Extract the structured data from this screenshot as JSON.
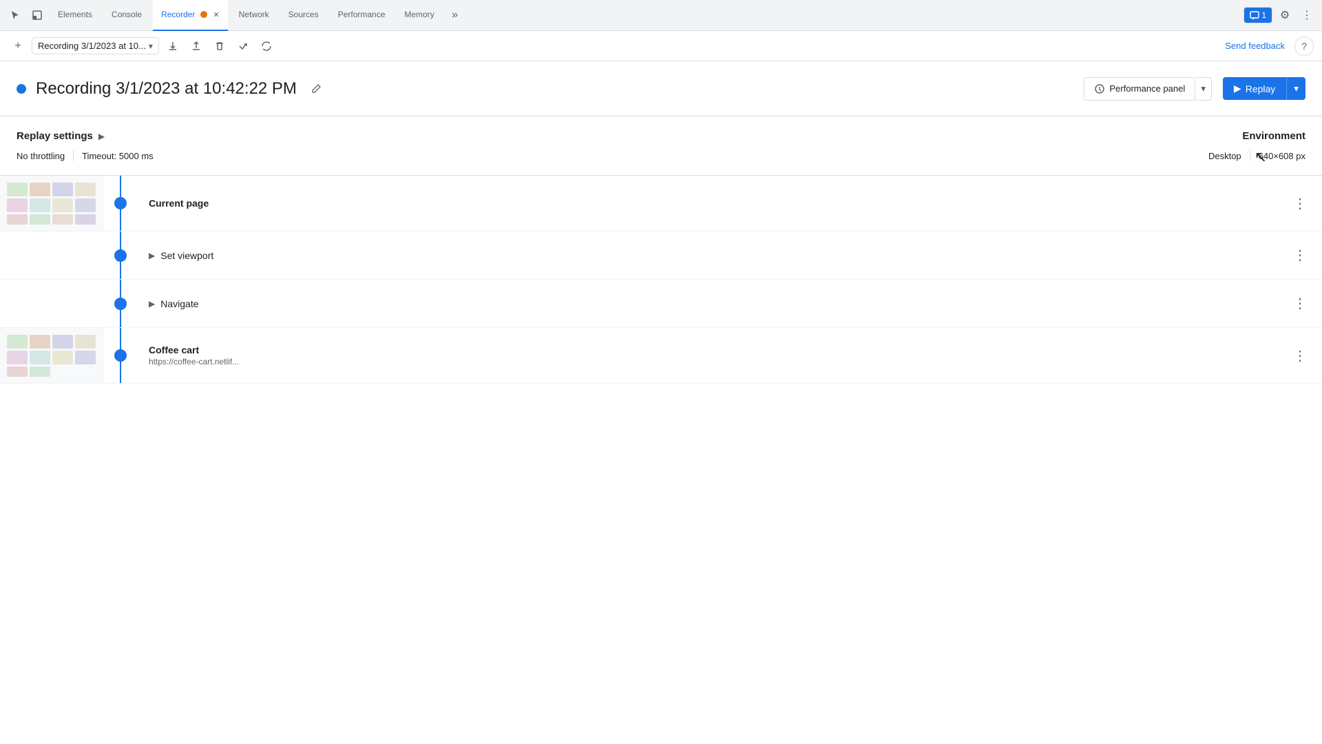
{
  "tabs": {
    "cursor_icon": "↖",
    "items": [
      {
        "id": "elements",
        "label": "Elements",
        "active": false
      },
      {
        "id": "console",
        "label": "Console",
        "active": false
      },
      {
        "id": "recorder",
        "label": "Recorder",
        "active": true,
        "has_close": true
      },
      {
        "id": "network",
        "label": "Network",
        "active": false
      },
      {
        "id": "sources",
        "label": "Sources",
        "active": false
      },
      {
        "id": "performance",
        "label": "Performance",
        "active": false
      },
      {
        "id": "memory",
        "label": "Memory",
        "active": false
      }
    ],
    "more_label": "»",
    "notification": {
      "count": "1"
    },
    "gear_icon": "⚙",
    "more_dots": "⋮"
  },
  "toolbar": {
    "add_icon": "+",
    "recording_name": "Recording 3/1/2023 at 10...",
    "dropdown_arrow": "▾",
    "export_icon": "↑",
    "import_icon": "↓",
    "delete_icon": "🗑",
    "step_over_icon": "⏭",
    "loop_icon": "↺",
    "send_feedback_label": "Send feedback",
    "help_icon": "?"
  },
  "recording": {
    "dot_color": "#1a73e8",
    "title": "Recording 3/1/2023 at 10:42:22 PM",
    "edit_icon": "✎",
    "performance_panel_label": "Performance panel",
    "performance_icon": "⚡",
    "replay_label": "Replay",
    "replay_icon": "▶",
    "chevron": "▾"
  },
  "settings": {
    "title": "Replay settings",
    "expand_icon": "▶",
    "throttling": "No throttling",
    "timeout": "Timeout: 5000 ms",
    "environment_title": "Environment",
    "env_type": "Desktop",
    "env_resolution": "640×608 px"
  },
  "steps": [
    {
      "id": "current-page",
      "name": "Current page",
      "url": "",
      "has_thumbnail": true,
      "sub_steps": [
        {
          "id": "set-viewport",
          "name": "Set viewport",
          "expandable": true
        },
        {
          "id": "navigate",
          "name": "Navigate",
          "expandable": true
        }
      ]
    },
    {
      "id": "coffee-cart",
      "name": "Coffee cart",
      "url": "https://coffee-cart.netlif...",
      "has_thumbnail": true,
      "sub_steps": []
    }
  ]
}
